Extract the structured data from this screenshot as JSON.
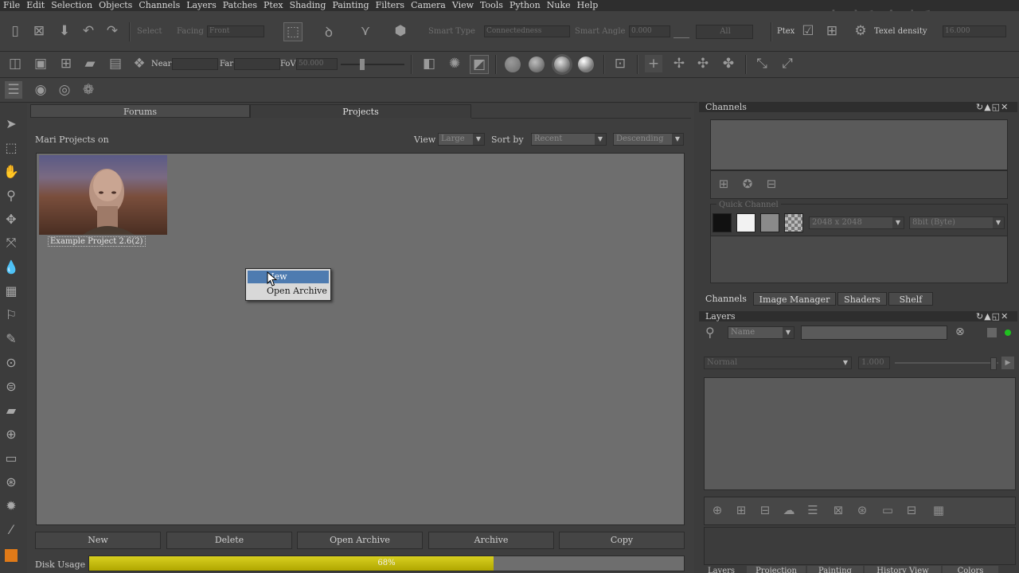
{
  "menubar": [
    "File",
    "Edit",
    "Selection",
    "Objects",
    "Channels",
    "Layers",
    "Patches",
    "Ptex",
    "Shading",
    "Painting",
    "Filters",
    "Camera",
    "View",
    "Tools",
    "Python",
    "Nuke",
    "Help"
  ],
  "toolbar1": {
    "select_label": "Select",
    "facing_label": "Facing",
    "facing_value": "Front",
    "smart_type_label": "Smart Type",
    "smart_type_value": "Connectedness",
    "smart_angle_label": "Smart Angle",
    "smart_angle_value": "0.000",
    "all_button": "All",
    "ptex_label": "Ptex",
    "texel_density_label": "Texel density",
    "texel_density_value": "16.000"
  },
  "toolbar2": {
    "near_label": "Near",
    "far_label": "Far",
    "fov_label": "FoV",
    "fov_value": "50.000"
  },
  "watermark": "中新金桥",
  "center": {
    "tabs": [
      "Forums",
      "Projects"
    ],
    "active_tab": "Projects",
    "projects_on_label": "Mari Projects on",
    "view_label": "View",
    "view_value": "Large",
    "sort_label": "Sort by",
    "sort_value": "Recent",
    "order_value": "Descending",
    "project": {
      "name": "Example Project 2.6(2)"
    },
    "buttons": {
      "new": "New",
      "delete": "Delete",
      "open_archive": "Open Archive",
      "archive": "Archive",
      "copy": "Copy"
    },
    "disk_usage_label": "Disk Usage",
    "disk_usage_percent": 68,
    "disk_usage_text": "68%"
  },
  "context_menu": {
    "items": [
      "New",
      "Open Archive"
    ],
    "highlighted": "New"
  },
  "channels_panel": {
    "title": "Channels",
    "quick_channel_label": "Quick Channel",
    "size_value": "2048 x 2048",
    "depth_value": "8bit (Byte)"
  },
  "right_tabs": [
    "Channels",
    "Image Manager",
    "Shaders",
    "Shelf"
  ],
  "layers_panel": {
    "title": "Layers",
    "filter_value": "Name",
    "blend_value": "Normal",
    "opacity_value": "1.000"
  },
  "bottom_tabs": [
    "Layers",
    "Projection",
    "Painting",
    "History View",
    "Colors"
  ],
  "colors": {
    "accent": "#4e7bb0",
    "disk_bar": "#c8c000",
    "swatch_orange": "#e07a18"
  }
}
